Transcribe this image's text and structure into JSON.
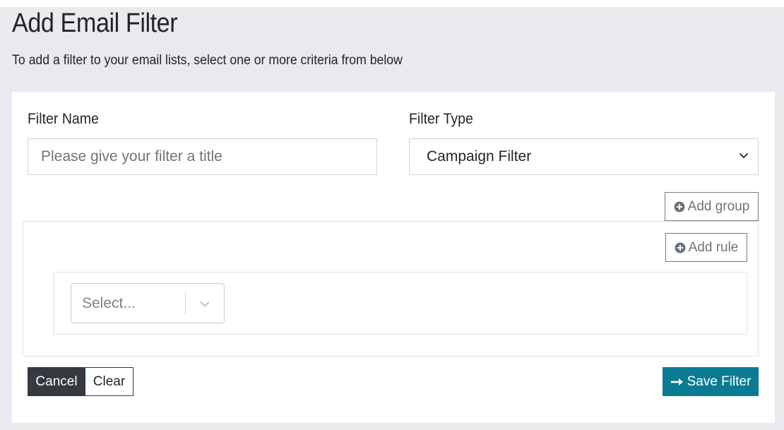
{
  "header": {
    "title": "Add Email Filter",
    "subtitle": "To add a filter to your email lists, select one or more criteria from below"
  },
  "form": {
    "filter_name": {
      "label": "Filter Name",
      "value": "",
      "placeholder": "Please give your filter a title"
    },
    "filter_type": {
      "label": "Filter Type",
      "selected": "Campaign Filter"
    }
  },
  "builder": {
    "add_group_label": "Add group",
    "add_rule_label": "Add rule",
    "rule_select_placeholder": "Select..."
  },
  "actions": {
    "cancel_label": "Cancel",
    "clear_label": "Clear",
    "save_label": "Save Filter"
  },
  "icons": {
    "plus_circle": "plus-circle-icon",
    "chevron_down": "chevron-down-icon",
    "arrow_right": "arrow-right-icon"
  },
  "colors": {
    "primary_save": "#0a7b93",
    "dark_button": "#343a40",
    "page_background": "#e9e9ee"
  }
}
